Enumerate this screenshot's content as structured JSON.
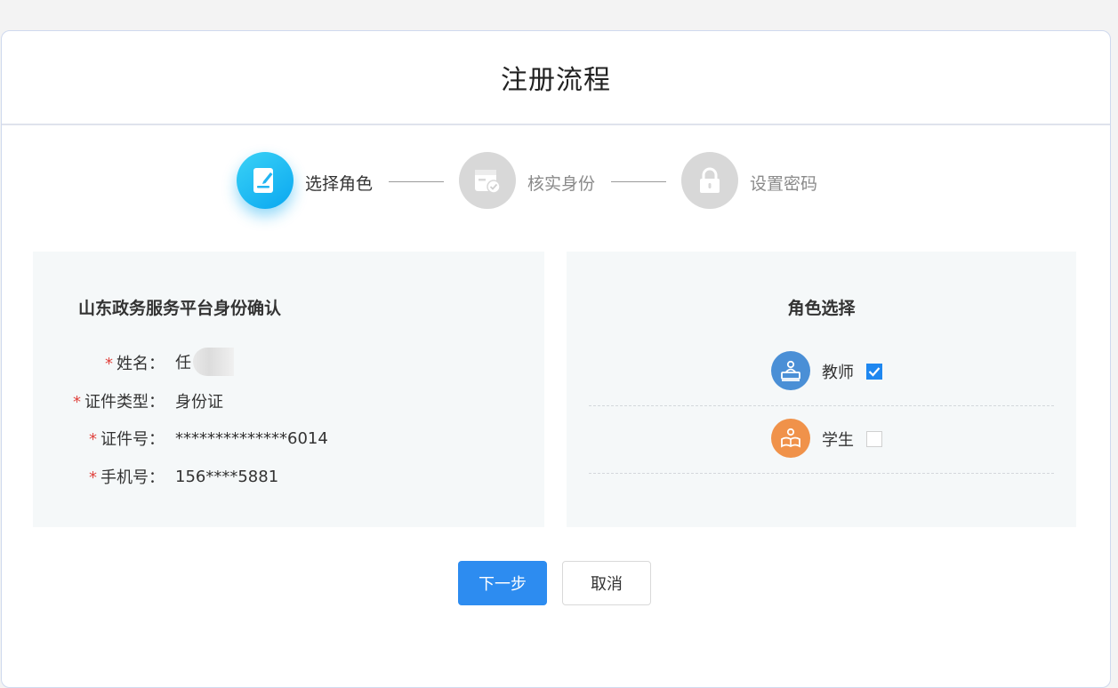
{
  "header": {
    "title": "注册流程"
  },
  "steps": [
    {
      "label": "选择角色",
      "state": "active",
      "icon": "edit-document-icon"
    },
    {
      "label": "核实身份",
      "state": "inactive",
      "icon": "calendar-check-icon"
    },
    {
      "label": "设置密码",
      "state": "inactive",
      "icon": "lock-icon"
    }
  ],
  "identity": {
    "title": "山东政务服务平台身份确认",
    "required_mark": "*",
    "fields": [
      {
        "label": "姓名：",
        "value": "任"
      },
      {
        "label": "证件类型：",
        "value": "身份证"
      },
      {
        "label": "证件号：",
        "value": "**************6014"
      },
      {
        "label": "手机号：",
        "value": "156****5881"
      }
    ]
  },
  "roles": {
    "title": "角色选择",
    "items": [
      {
        "label": "教师",
        "checked": true,
        "icon": "teacher-icon",
        "color": "#4a8fd6"
      },
      {
        "label": "学生",
        "checked": false,
        "icon": "student-icon",
        "color": "#f0924a"
      }
    ]
  },
  "actions": {
    "next_label": "下一步",
    "cancel_label": "取消"
  },
  "colors": {
    "primary": "#2d8cf0",
    "step_active": "#14b4f2",
    "required": "#e0433e"
  }
}
